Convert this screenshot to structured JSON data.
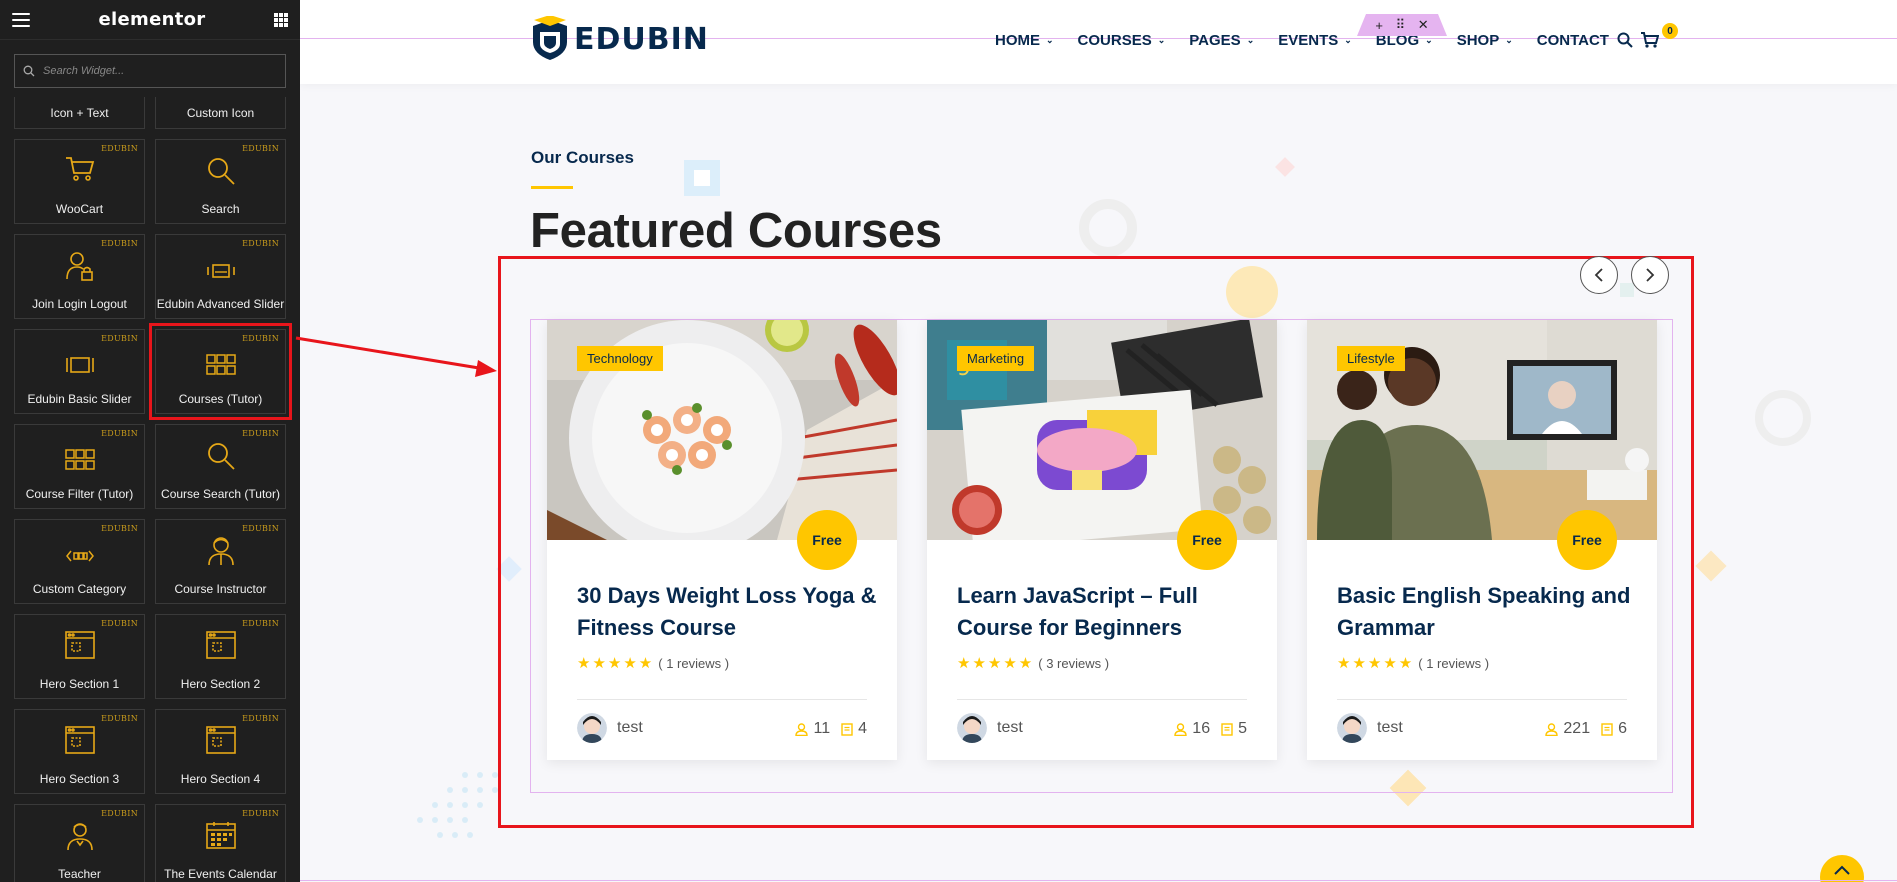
{
  "sidebar": {
    "brand": "elementor",
    "search_placeholder": "Search Widget...",
    "tag": "EDUBIN",
    "partial_row": [
      "Icon + Text",
      "Custom Icon"
    ],
    "widgets": [
      [
        "WooCart",
        "Search"
      ],
      [
        "Join Login Logout",
        "Edubin Advanced Slider"
      ],
      [
        "Edubin Basic Slider",
        "Courses (Tutor)"
      ],
      [
        "Course Filter (Tutor)",
        "Course Search (Tutor)"
      ],
      [
        "Custom Category",
        "Course Instructor"
      ],
      [
        "Hero Section 1",
        "Hero Section 2"
      ],
      [
        "Hero Section 3",
        "Hero Section 4"
      ],
      [
        "Teacher",
        "The Events Calendar"
      ]
    ],
    "highlighted_widget": "Courses (Tutor)"
  },
  "header": {
    "logo_text": "EDUBIN",
    "nav": [
      {
        "label": "HOME",
        "dropdown": true
      },
      {
        "label": "COURSES",
        "dropdown": true
      },
      {
        "label": "PAGES",
        "dropdown": true
      },
      {
        "label": "EVENTS",
        "dropdown": true
      },
      {
        "label": "BLOG",
        "dropdown": true
      },
      {
        "label": "SHOP",
        "dropdown": true
      },
      {
        "label": "CONTACT",
        "dropdown": false
      }
    ],
    "cart_count": "0",
    "edit_handle": {
      "add": "+",
      "move": "⠿",
      "close": "✕"
    }
  },
  "section": {
    "subtitle": "Our Courses",
    "title": "Featured Courses"
  },
  "courses": [
    {
      "category": "Technology",
      "price": "Free",
      "title": "30 Days Weight Loss Yoga & Fitness Course",
      "stars": "★★★★★",
      "reviews": "( 1 reviews )",
      "author": "test",
      "students": "11",
      "lessons": "4"
    },
    {
      "category": "Marketing",
      "price": "Free",
      "title": "Learn JavaScript – Full Course for Beginners",
      "stars": "★★★★★",
      "reviews": "( 3 reviews )",
      "author": "test",
      "students": "16",
      "lessons": "5"
    },
    {
      "category": "Lifestyle",
      "price": "Free",
      "title": "Basic English Speaking and Grammar",
      "stars": "★★★★★",
      "reviews": "( 1 reviews )",
      "author": "test",
      "students": "221",
      "lessons": "6"
    }
  ],
  "colors": {
    "accent": "#ffc600",
    "navy": "#07294d",
    "annotation": "#e8151b",
    "guide": "#e3b3ef"
  }
}
